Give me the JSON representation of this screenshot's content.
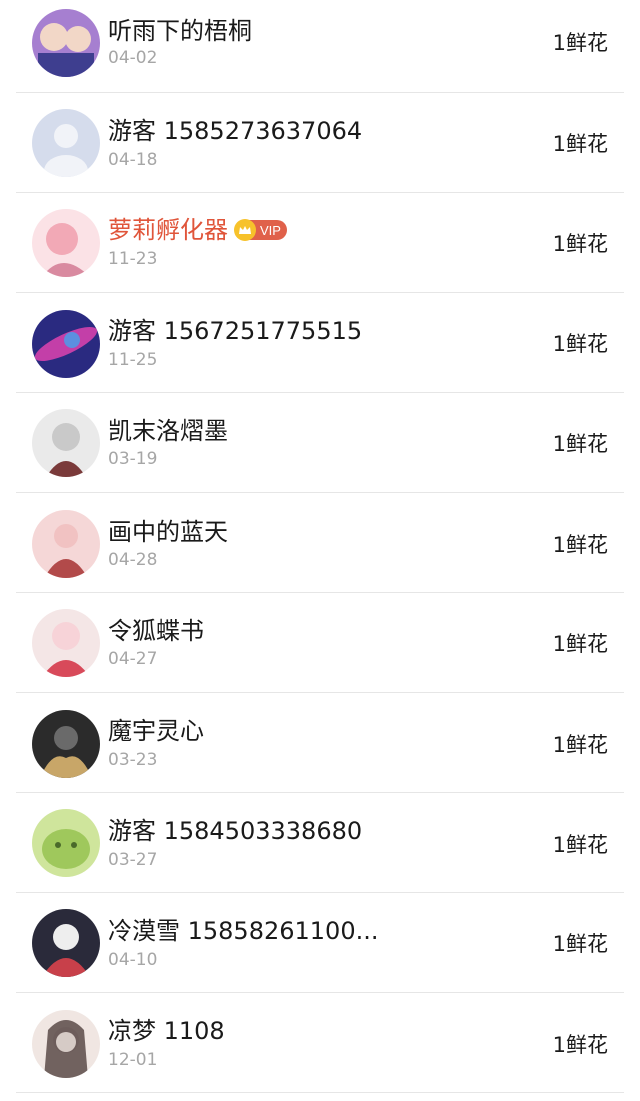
{
  "rows": [
    {
      "name": "听雨下的梧桐",
      "date": "04-02",
      "gift": "1鲜花",
      "vip": false,
      "avatar_colors": [
        "#a67fd0",
        "#3e3e8f",
        "#f2d7c7"
      ]
    },
    {
      "name": "游客 1585273637064",
      "date": "04-18",
      "gift": "1鲜花",
      "vip": false,
      "avatar_colors": [
        "#d5dcec",
        "#f1f3f8",
        "#d5dcec"
      ]
    },
    {
      "name": "萝莉孵化器",
      "date": "11-23",
      "gift": "1鲜花",
      "vip": true,
      "vip_label": "VIP",
      "avatar_colors": [
        "#f2a9b6",
        "#fbe2e6",
        "#d98aa0"
      ]
    },
    {
      "name": "游客 1567251775515",
      "date": "11-25",
      "gift": "1鲜花",
      "vip": false,
      "avatar_colors": [
        "#2a2a80",
        "#c33fa8",
        "#5c8fe0"
      ]
    },
    {
      "name": "凯末洛熠墨",
      "date": "03-19",
      "gift": "1鲜花",
      "vip": false,
      "avatar_colors": [
        "#c9c9c9",
        "#7a3a3a",
        "#eaeaea"
      ]
    },
    {
      "name": "画中的蓝天",
      "date": "04-28",
      "gift": "1鲜花",
      "vip": false,
      "avatar_colors": [
        "#f5d7d7",
        "#b24a4a",
        "#f1c2c2"
      ]
    },
    {
      "name": "令狐蝶书",
      "date": "04-27",
      "gift": "1鲜花",
      "vip": false,
      "avatar_colors": [
        "#f7d3d8",
        "#d84a5a",
        "#f4e6e6"
      ]
    },
    {
      "name": "魔宇灵心",
      "date": "03-23",
      "gift": "1鲜花",
      "vip": false,
      "avatar_colors": [
        "#2b2b2b",
        "#c8a668",
        "#6a6a6a"
      ]
    },
    {
      "name": "游客 1584503338680",
      "date": "03-27",
      "gift": "1鲜花",
      "vip": false,
      "avatar_colors": [
        "#9fc85c",
        "#cfe59c",
        "#4a6a2a"
      ]
    },
    {
      "name": "冷漠雪 15858261100...",
      "date": "04-10",
      "gift": "1鲜花",
      "vip": false,
      "avatar_colors": [
        "#2a2a3a",
        "#c8404a",
        "#eeeeee"
      ]
    },
    {
      "name": "凉梦 1108",
      "date": "12-01",
      "gift": "1鲜花",
      "vip": false,
      "avatar_colors": [
        "#d6cbc6",
        "#5a4a48",
        "#f0e6e2"
      ]
    }
  ]
}
